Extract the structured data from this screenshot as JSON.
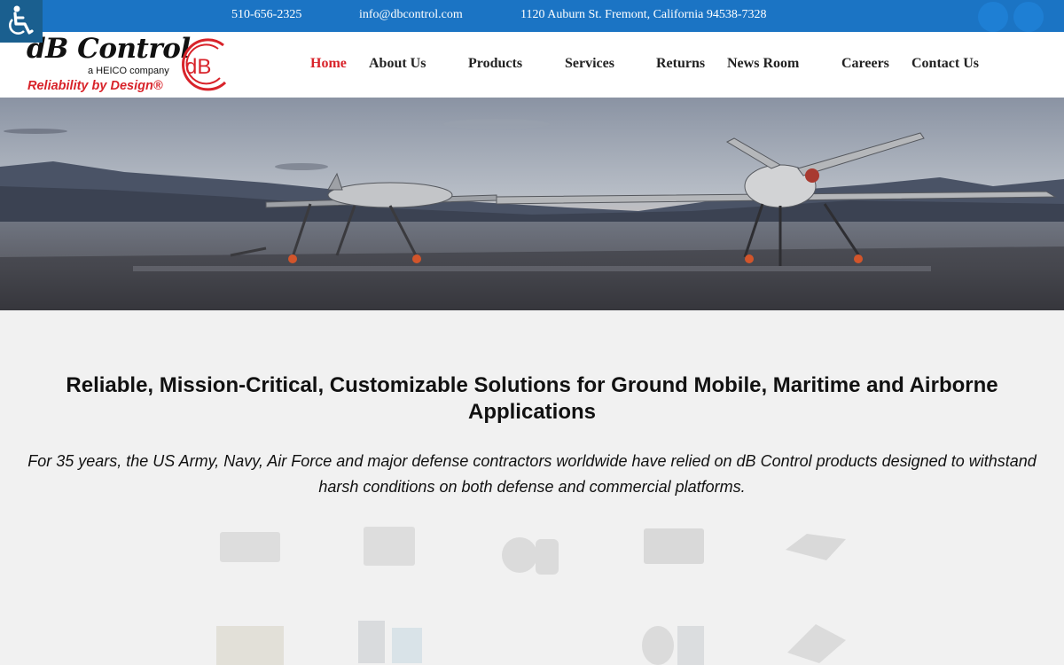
{
  "topbar": {
    "phone": "510-656-2325",
    "email": "info@dbcontrol.com",
    "address": "1120 Auburn St. Fremont, California 94538-7328"
  },
  "accessibility": {
    "icon": "wheelchair-icon"
  },
  "logo": {
    "name": "dB Control",
    "parent": "a HEICO company",
    "tagline": "Reliability by Design®",
    "mark": "dB"
  },
  "nav": {
    "home": "Home",
    "about": "About Us",
    "products": "Products",
    "services": "Services",
    "returns": "Returns",
    "news": "News Room",
    "careers": "Careers",
    "contact": "Contact Us"
  },
  "main": {
    "headline": "Reliable, Mission-Critical, Customizable Solutions for Ground Mobile, Maritime and Airborne Applications",
    "intro": "For 35 years, the US Army, Navy, Air Force and major defense contractors worldwide have relied on dB Control products designed to withstand harsh conditions on both defense and commercial platforms."
  },
  "colors": {
    "topbar": "#1b74c4",
    "accent": "#d8232a",
    "background": "#f1f1f1"
  }
}
